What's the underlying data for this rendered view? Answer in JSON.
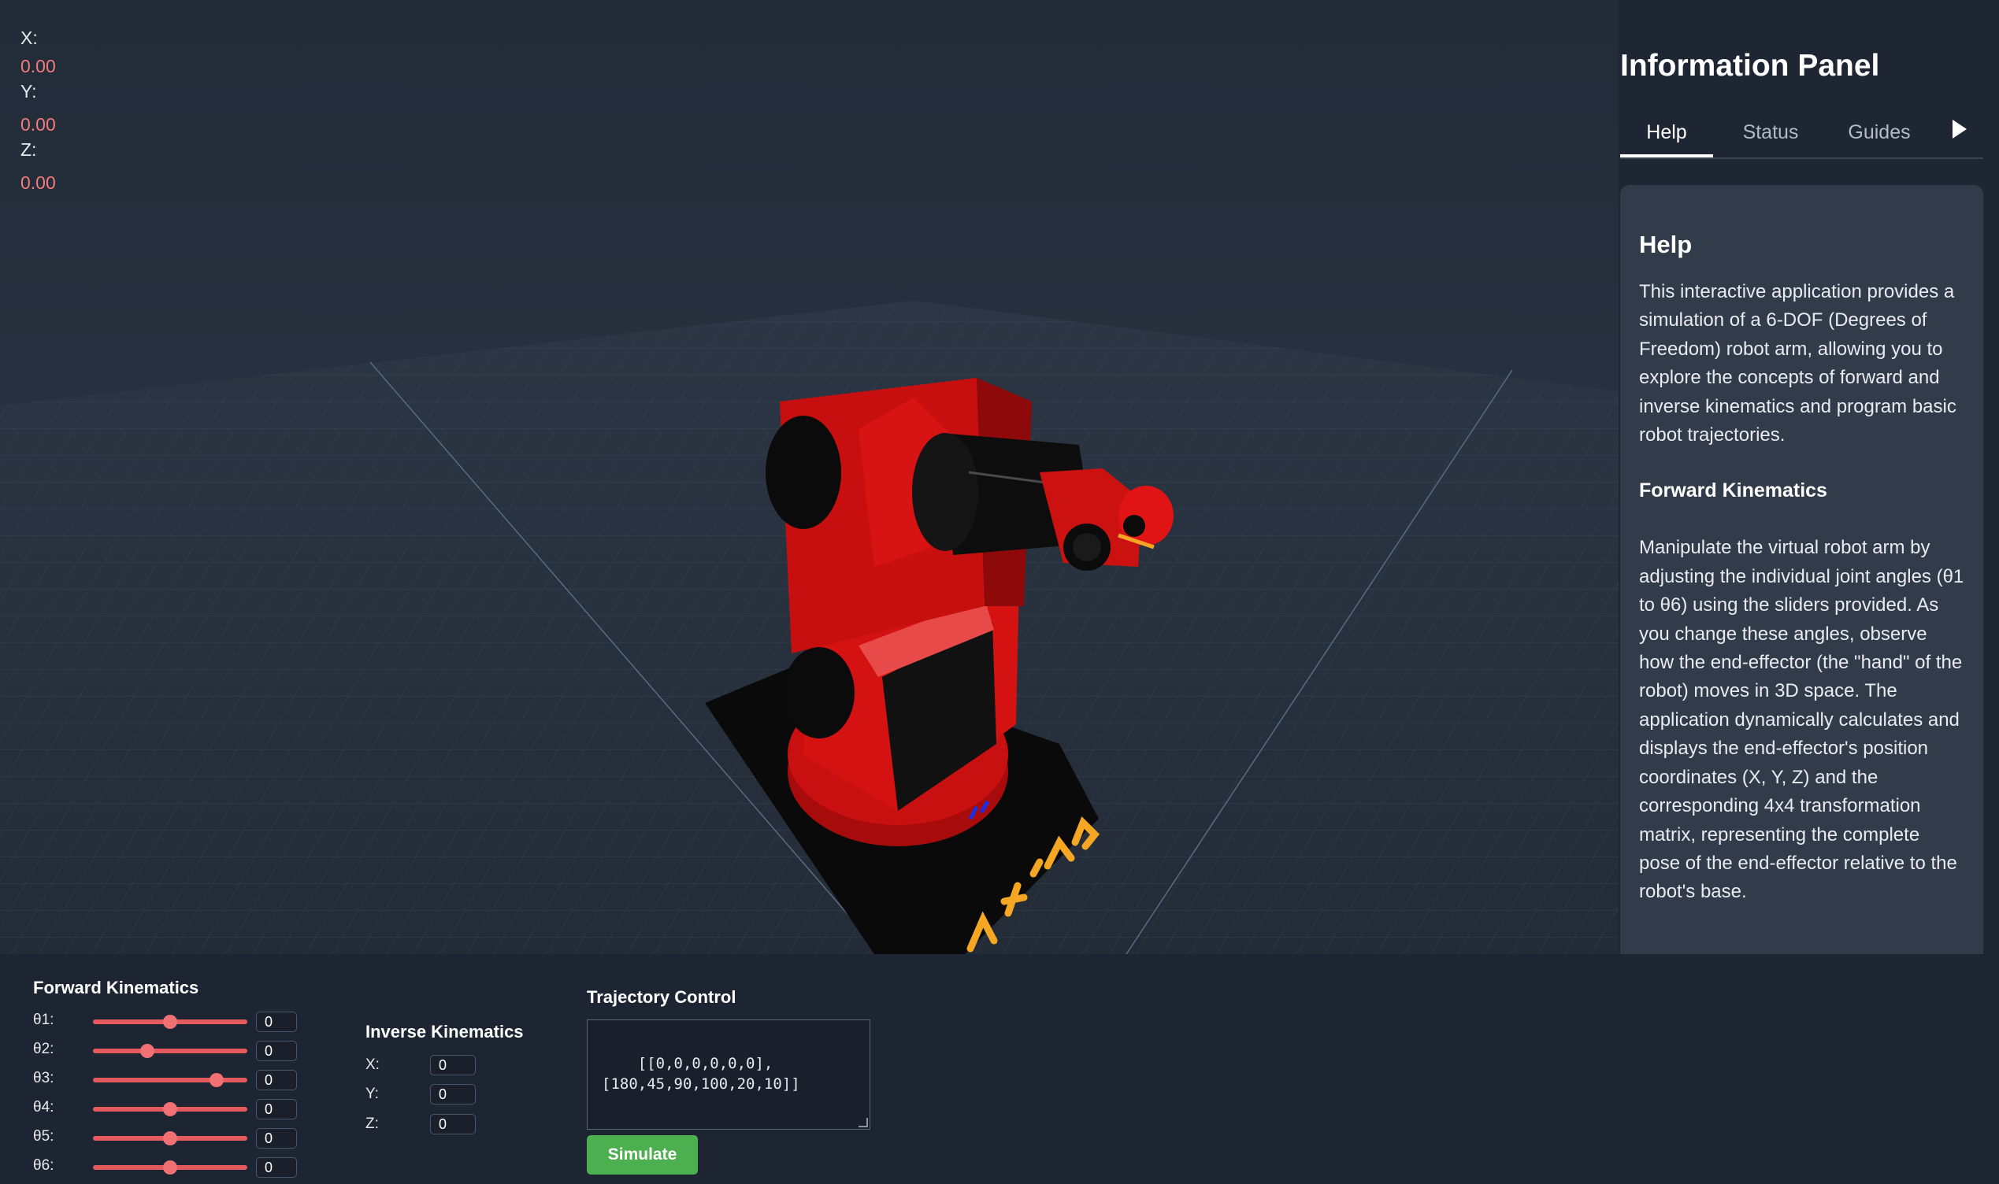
{
  "viewport": {
    "coords": [
      {
        "label": "X:",
        "value": "0.00"
      },
      {
        "label": "Y:",
        "value": "0.00"
      },
      {
        "label": "Z:",
        "value": "0.00"
      }
    ],
    "colors": {
      "robot_red": "#c20d0d",
      "joint_black": "#0b0b0b",
      "label_orange": "#f5a623",
      "grid": "#3d4a5c"
    }
  },
  "info_panel": {
    "title": "Information Panel",
    "tabs": [
      "Help",
      "Status",
      "Guides"
    ],
    "active_tab": "Help",
    "next_icon": "play-right-icon",
    "help": {
      "heading": "Help",
      "intro": "This interactive application provides a simulation of a 6-DOF (Degrees of Freedom) robot arm, allowing you to explore the concepts of forward and inverse kinematics and program basic robot trajectories.",
      "fk_heading": "Forward Kinematics",
      "fk_text": "Manipulate the virtual robot arm by adjusting the individual joint angles (θ1 to θ6) using the sliders provided. As you change these angles, observe how the end-effector (the \"hand\" of the robot) moves in 3D space. The application dynamically calculates and displays the end-effector's position coordinates (X, Y, Z) and the corresponding 4x4 transformation matrix, representing the complete pose of the end-effector relative to the robot's base."
    }
  },
  "forward_kinematics": {
    "title": "Forward Kinematics",
    "joints": [
      {
        "label": "θ1:",
        "value": "0",
        "slider_fraction": 0.5
      },
      {
        "label": "θ2:",
        "value": "0",
        "slider_fraction": 0.35
      },
      {
        "label": "θ3:",
        "value": "0",
        "slider_fraction": 0.8
      },
      {
        "label": "θ4:",
        "value": "0",
        "slider_fraction": 0.5
      },
      {
        "label": "θ5:",
        "value": "0",
        "slider_fraction": 0.5
      },
      {
        "label": "θ6:",
        "value": "0",
        "slider_fraction": 0.5
      }
    ],
    "slider_color": "#e55a5e"
  },
  "inverse_kinematics": {
    "title": "Inverse Kinematics",
    "fields": [
      {
        "label": "X:",
        "value": "0"
      },
      {
        "label": "Y:",
        "value": "0"
      },
      {
        "label": "Z:",
        "value": "0"
      }
    ]
  },
  "trajectory": {
    "title": "Trajectory Control",
    "text": "[[0,0,0,0,0,0],\n[180,45,90,100,20,10]]",
    "button_label": "Simulate",
    "button_color": "#4caf50"
  }
}
